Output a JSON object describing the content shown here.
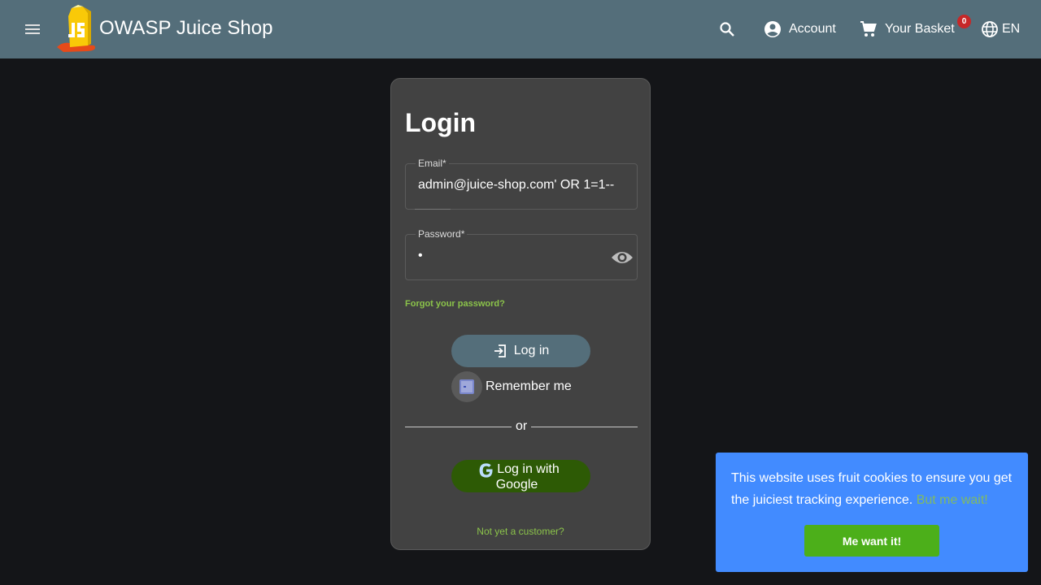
{
  "header": {
    "menu_icon": "menu-icon",
    "title": "OWASP Juice Shop",
    "search_icon": "search-icon",
    "account_label": "Account",
    "account_icon": "account-circle-icon",
    "basket_label": "Your Basket",
    "basket_icon": "cart-icon",
    "basket_count": "0",
    "language_label": "EN",
    "language_icon": "globe-icon"
  },
  "login": {
    "title": "Login",
    "email_label": "Email*",
    "email_value": "admin@juice-shop.com' OR 1=1--",
    "password_label": "Password*",
    "password_value": "•",
    "password_toggle_icon": "eye-icon",
    "forgot_password": "Forgot your password?",
    "login_button": "Log in",
    "login_icon": "login-icon",
    "remember_me": "Remember me",
    "divider_text": "or",
    "google_button_line1": "Log in with",
    "google_button_line2": "Google",
    "google_icon": "google-icon",
    "signup_link": "Not yet a customer?"
  },
  "cookie_banner": {
    "message": "This website uses fruit cookies to ensure you get the juiciest tracking experience.",
    "link": "But me wait!",
    "button": "Me want it!"
  },
  "colors": {
    "toolbar": "#546e7a",
    "background": "#141518",
    "card": "#424242",
    "accent_green": "#8bc34a",
    "cookie_banner": "#428bff",
    "badge": "#c62828"
  }
}
